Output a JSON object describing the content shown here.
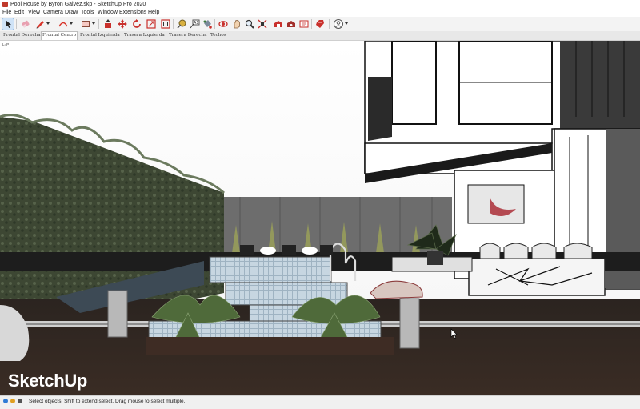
{
  "window": {
    "title": "Pool House by Byron Galvez.skp - SketchUp Pro 2020"
  },
  "menu": [
    "File",
    "Edit",
    "View",
    "Camera",
    "Draw",
    "Tools",
    "Window",
    "Extensions",
    "Help"
  ],
  "toolbar": {
    "icons": [
      "select-icon",
      "eraser-icon",
      "line-pencil-icon",
      "arc-icon",
      "rectangle-icon",
      "push-pull-icon",
      "move-icon",
      "rotate-icon",
      "scale-icon",
      "offset-icon",
      "tape-measure-icon",
      "text-icon",
      "paint-bucket-icon",
      "orbit-icon",
      "pan-icon",
      "zoom-icon",
      "zoom-extents-icon",
      "3d-warehouse-icon",
      "extension-warehouse-icon",
      "layout-icon",
      "ruby-icon",
      "account-icon"
    ]
  },
  "scene_tabs": [
    "Frontal Derecha",
    "Frontal Centro",
    "Frontal Izquierda",
    "Trasera Izquierda",
    "Trasera Derecha",
    "Techos"
  ],
  "active_scene_tab": "Frontal Centro",
  "viewport": {
    "corner_label": "L=P"
  },
  "watermark": "SketchUp",
  "status": {
    "message": "Select objects. Shift to extend select. Drag mouse to select multiple."
  },
  "colors": {
    "accent": "#c0392b",
    "selected_tool": "#cfe3f7"
  }
}
